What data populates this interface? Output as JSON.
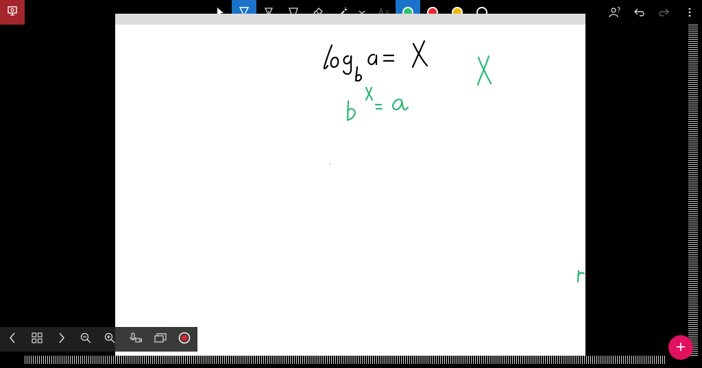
{
  "toolbar": {
    "tools": [
      {
        "name": "select-tool",
        "icon": "arrow-pointer-icon"
      },
      {
        "name": "pen-tool",
        "icon": "pen-icon",
        "active": true
      },
      {
        "name": "pen-tool-2",
        "icon": "pen-tip-icon"
      },
      {
        "name": "highlighter-tool",
        "icon": "highlighter-icon"
      },
      {
        "name": "eraser-tool",
        "icon": "eraser-icon"
      },
      {
        "name": "laser-pointer-tool",
        "icon": "laser-icon"
      },
      {
        "name": "more-tools",
        "icon": "chevron-down-icon"
      },
      {
        "name": "text-tool",
        "icon": "text-icon"
      }
    ],
    "colors": [
      "#2cc36b",
      "#e8262c",
      "#f5b800",
      "#000000"
    ],
    "active_color": "#2cc36b",
    "accent": "#1a73c9"
  },
  "fab": {
    "label": "+",
    "color": "#e0115f"
  },
  "ink": {
    "black": "#000000",
    "green": "#2bb673"
  }
}
